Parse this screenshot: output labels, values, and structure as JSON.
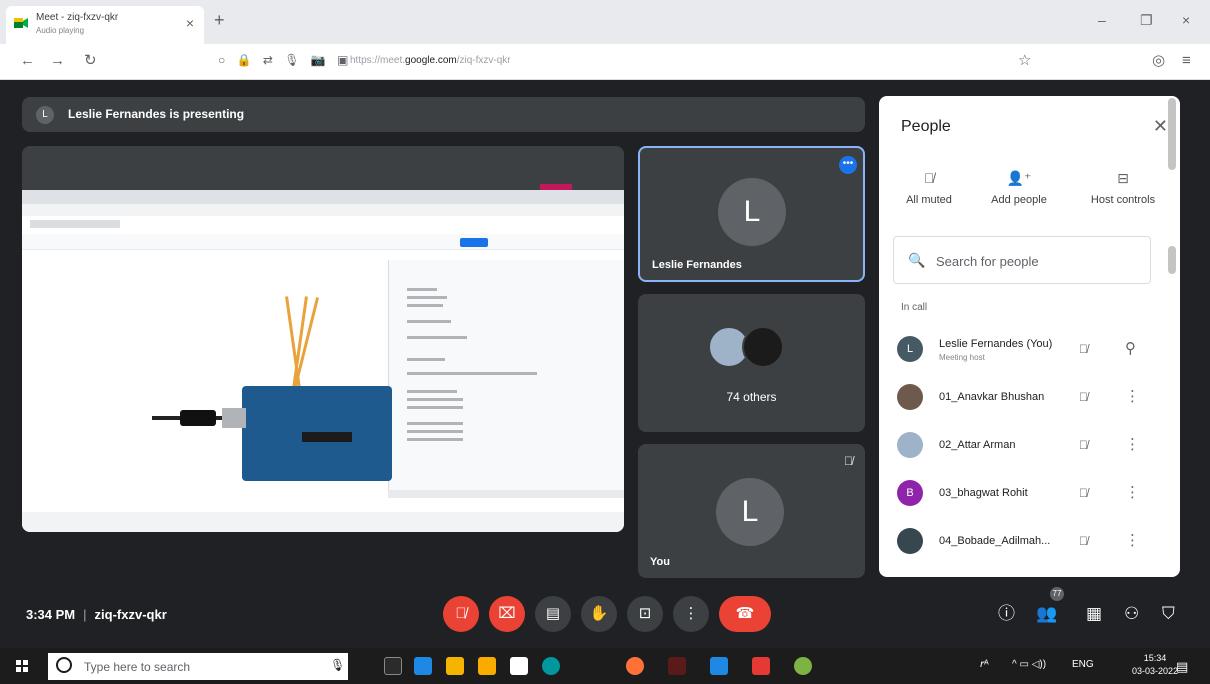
{
  "browser": {
    "tab_title": "Meet - ziq-fxzv-qkr",
    "tab_subtitle": "Audio playing",
    "tab_close": "×",
    "new_tab": "+",
    "win_min": "–",
    "win_max": "❐",
    "win_close": "×",
    "url_host": "https://meet.google.com/",
    "url_domain": "google.com",
    "url_path": "ziq-fxzv-qkr",
    "url_prefix": "https://meet.",
    "url_suffix": "/ziq-fxzv-qkr"
  },
  "meet": {
    "presenter_initial": "L",
    "presenting_text": "Leslie Fernandes is presenting",
    "tiles": {
      "presenter": {
        "initial": "L",
        "name": "Leslie Fernandes"
      },
      "others": {
        "label": "74 others"
      },
      "self": {
        "initial": "L",
        "name": "You"
      }
    },
    "time": "3:34 PM",
    "meeting_code": "ziq-fxzv-qkr",
    "separator": "|",
    "participant_count": "77"
  },
  "people_panel": {
    "title": "People",
    "actions": [
      {
        "label": "All muted"
      },
      {
        "label": "Add people"
      },
      {
        "label": "Host controls"
      }
    ],
    "search_placeholder": "Search for people",
    "section_label": "In call",
    "participants": [
      {
        "initial": "L",
        "name": "Leslie Fernandes (You)",
        "subtitle": "Meeting host",
        "color": "#455a64"
      },
      {
        "initial": "",
        "name": "01_Anavkar Bhushan",
        "subtitle": "",
        "color": "#6d5a4d"
      },
      {
        "initial": "",
        "name": "02_Attar Arman",
        "subtitle": "",
        "color": "#9fb3c8"
      },
      {
        "initial": "B",
        "name": "03_bhagwat Rohit",
        "subtitle": "",
        "color": "#8e24aa"
      },
      {
        "initial": "",
        "name": "04_Bobade_Adilmah...",
        "subtitle": "",
        "color": "#37474f"
      }
    ]
  },
  "taskbar": {
    "search_placeholder": "Type here to search",
    "tray_lang": "ENG",
    "clock_time": "15:34",
    "clock_date": "03-03-2022"
  },
  "colors": {
    "meet_bg": "#202124",
    "tile_bg": "#3c4043",
    "end_call": "#ea4335",
    "accent": "#1a73e8",
    "active_border": "#8ab4f8"
  }
}
